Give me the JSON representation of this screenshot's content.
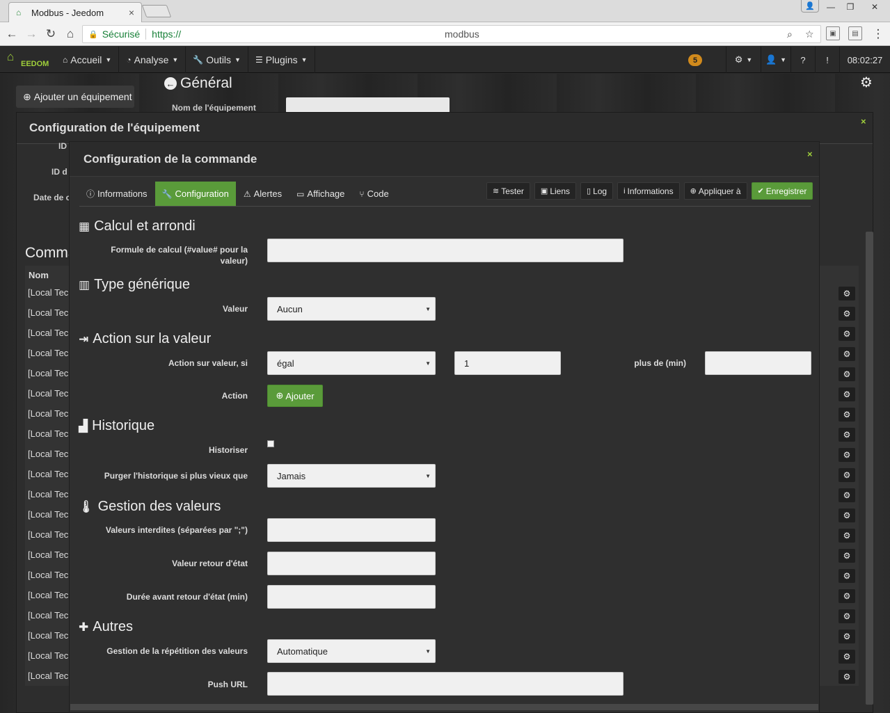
{
  "browser": {
    "tab_title": "Modbus - Jeedom",
    "secure_label": "Sécurisé",
    "url_scheme": "https://",
    "url_path": "modbus"
  },
  "navbar": {
    "items": [
      {
        "label": "Accueil",
        "icon": "home-icon"
      },
      {
        "label": "Analyse",
        "icon": "dashboard-icon"
      },
      {
        "label": "Outils",
        "icon": "wrench-icon"
      },
      {
        "label": "Plugins",
        "icon": "tasks-icon"
      }
    ],
    "badge": "5",
    "time": "08:02:27"
  },
  "page": {
    "add_equipment": "Ajouter un équipement",
    "general_title": "Général",
    "eq_name_label": "Nom de l'équipement",
    "left_labels": [
      "ID",
      "ID d",
      "Date de c"
    ],
    "commands_title": "Comma",
    "table_header": "Nom",
    "row_label": "[Local Tech"
  },
  "outer_modal": {
    "title": "Configuration de l'équipement"
  },
  "inner_modal": {
    "title": "Configuration de la commande",
    "tabs": [
      {
        "label": "Informations",
        "icon": "info-circle-icon"
      },
      {
        "label": "Configuration",
        "icon": "wrench-icon"
      },
      {
        "label": "Alertes",
        "icon": "warning-icon"
      },
      {
        "label": "Affichage",
        "icon": "desktop-icon"
      },
      {
        "label": "Code",
        "icon": "code-fork-icon"
      }
    ],
    "actions": [
      {
        "label": "Tester",
        "icon": "rss-icon"
      },
      {
        "label": "Liens",
        "icon": "sitemap-icon"
      },
      {
        "label": "Log",
        "icon": "file-icon"
      },
      {
        "label": "Informations",
        "icon": "info-icon"
      },
      {
        "label": "Appliquer à",
        "icon": "plus-circle-icon"
      },
      {
        "label": "Enregistrer",
        "icon": "check-circle-icon"
      }
    ],
    "sections": {
      "calcul": {
        "title": "Calcul et arrondi",
        "formula_label_1": "Formule de calcul (#value# pour la",
        "formula_label_2": "valeur)",
        "formula_value": ""
      },
      "type": {
        "title": "Type générique",
        "valeur_label": "Valeur",
        "valeur_value": "Aucun"
      },
      "action": {
        "title": "Action sur la valeur",
        "condition_label": "Action sur valeur, si",
        "condition_value": "égal",
        "compare_value": "1",
        "duration_label": "plus de (min)",
        "duration_value": "",
        "action_label": "Action",
        "add_button": "Ajouter"
      },
      "historique": {
        "title": "Historique",
        "historize_label": "Historiser",
        "purge_label": "Purger l'historique si plus vieux que",
        "purge_value": "Jamais"
      },
      "gestion": {
        "title": "Gestion des valeurs",
        "forbidden_label": "Valeurs interdites (séparées par \";\")",
        "forbidden_value": "",
        "return_label": "Valeur retour d'état",
        "return_value": "",
        "duration_label": "Durée avant retour d'état (min)",
        "duration_value": ""
      },
      "autres": {
        "title": "Autres",
        "repeat_label": "Gestion de la répétition des valeurs",
        "repeat_value": "Automatique",
        "push_label": "Push URL",
        "push_value": ""
      }
    }
  },
  "colors": {
    "accent_green": "#5a9b3a",
    "logo_green": "#9fcf3b",
    "badge_orange": "#d18a1c",
    "background_dark": "#2f2f2f"
  }
}
